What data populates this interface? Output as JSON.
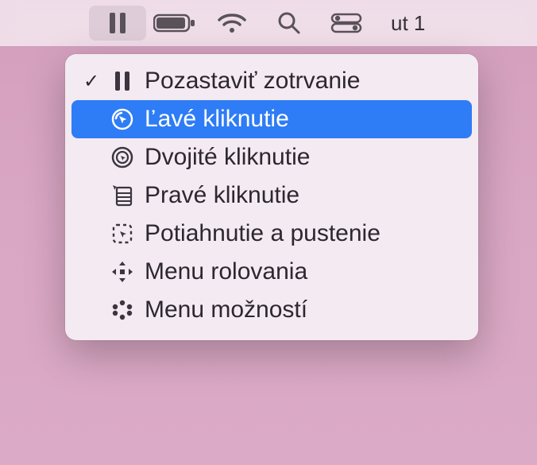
{
  "menubar": {
    "date_text": "ut 1",
    "icons": [
      {
        "name": "pause-icon",
        "active": true
      },
      {
        "name": "battery-icon",
        "active": false
      },
      {
        "name": "wifi-icon",
        "active": false
      },
      {
        "name": "search-icon",
        "active": false
      },
      {
        "name": "control-center-icon",
        "active": false
      }
    ]
  },
  "menu": {
    "items": [
      {
        "label": "Pozastaviť zotrvanie",
        "icon": "pause-icon",
        "checked": true,
        "highlighted": false
      },
      {
        "label": "Ľavé kliknutie",
        "icon": "left-click-icon",
        "checked": false,
        "highlighted": true
      },
      {
        "label": "Dvojité kliknutie",
        "icon": "double-click-icon",
        "checked": false,
        "highlighted": false
      },
      {
        "label": "Pravé kliknutie",
        "icon": "right-click-icon",
        "checked": false,
        "highlighted": false
      },
      {
        "label": "Potiahnutie a pustenie",
        "icon": "drag-drop-icon",
        "checked": false,
        "highlighted": false
      },
      {
        "label": "Menu rolovania",
        "icon": "scroll-menu-icon",
        "checked": false,
        "highlighted": false
      },
      {
        "label": "Menu možností",
        "icon": "options-menu-icon",
        "checked": false,
        "highlighted": false
      }
    ]
  }
}
